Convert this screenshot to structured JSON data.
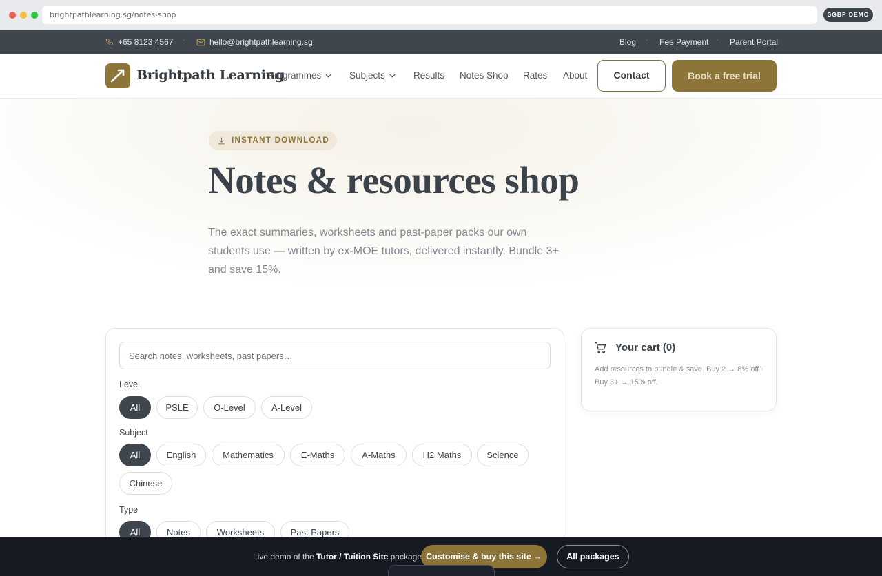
{
  "browser": {
    "url": "brightpathlearning.sg/notes-shop",
    "badge": "SGBP DEMO"
  },
  "topbar": {
    "phone": "+65 8123 4567",
    "email": "hello@brightpathlearning.sg",
    "links": [
      "Blog",
      "Fee Payment",
      "Parent Portal"
    ]
  },
  "nav": {
    "brand": "Brightpath Learning",
    "links": [
      "Programmes",
      "Subjects",
      "Results",
      "Notes Shop",
      "Rates",
      "About"
    ],
    "contact": "Contact",
    "trial": "Book a free trial"
  },
  "hero": {
    "badge": "INSTANT DOWNLOAD",
    "title": "Notes & resources shop",
    "subtitle": "The exact summaries, worksheets and past-paper packs our own students use — written by ex-MOE tutors, delivered instantly. Bundle 3+ and save 15%."
  },
  "filters": {
    "search_placeholder": "Search notes, worksheets, past papers…",
    "level_label": "Level",
    "levels": [
      "All",
      "PSLE",
      "O-Level",
      "A-Level"
    ],
    "subject_label": "Subject",
    "subjects": [
      "All",
      "English",
      "Mathematics",
      "E-Maths",
      "A-Maths",
      "H2 Maths",
      "Science",
      "Chinese"
    ],
    "type_label": "Type",
    "types": [
      "All",
      "Notes",
      "Worksheets",
      "Past Papers"
    ]
  },
  "cart": {
    "title": "Your cart (0)",
    "body": "Add resources to bundle & save. Buy 2 → 8% off · Buy 3+ → 15% off."
  },
  "demobar": {
    "text_prefix": "Live demo of the",
    "package": "Tutor / Tuition Site",
    "text_suffix": "package.",
    "buy": "Customise & buy this site →",
    "all": "All packages"
  }
}
